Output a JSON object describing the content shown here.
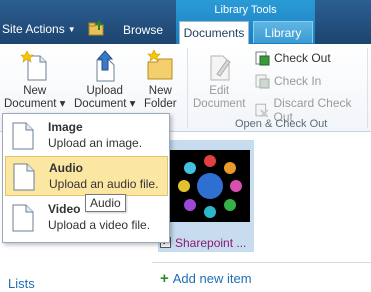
{
  "topbar": {
    "site_actions": "Site Actions",
    "browse": "Browse",
    "context_group": "Library Tools",
    "tabs": [
      {
        "label": "Documents",
        "active": true
      },
      {
        "label": "Library",
        "active": false
      }
    ]
  },
  "ribbon": {
    "new_document": [
      "New",
      "Document"
    ],
    "upload_document": [
      "Upload",
      "Document"
    ],
    "new_folder": [
      "New",
      "Folder"
    ],
    "edit_document": [
      "Edit",
      "Document"
    ],
    "check_out": "Check Out",
    "check_in": "Check In",
    "discard_check_out": "Discard Check Out",
    "group_open_checkout": "Open & Check Out"
  },
  "menu": {
    "items": [
      {
        "title": "Image",
        "desc": "Upload an image."
      },
      {
        "title": "Audio",
        "desc": "Upload an audio file."
      },
      {
        "title": "Video",
        "desc": "Upload a video file."
      }
    ],
    "tooltip": "Audio"
  },
  "content": {
    "lists_link": "Lists",
    "thumb_caption": "Sharepoint ...",
    "add_new_item": "Add new item"
  },
  "colors": {
    "ribbon_blue": "#1c446f",
    "context_blue": "#2a9bd6",
    "menu_hover": "#fbe6a2",
    "link_blue": "#1f6fb5"
  }
}
